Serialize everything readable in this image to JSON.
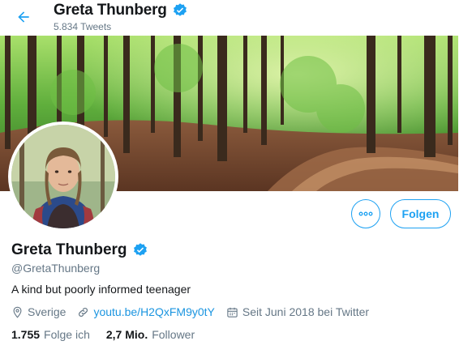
{
  "header": {
    "back_icon": "arrow-left-icon",
    "name": "Greta Thunberg",
    "verified_icon": "verified-badge-icon",
    "tweet_count": "5.834 Tweets"
  },
  "banner": {
    "description": "forest-path-photo"
  },
  "avatar": {
    "description": "profile-photo"
  },
  "actions": {
    "more_icon": "more-dots-icon",
    "follow_label": "Folgen"
  },
  "profile": {
    "name": "Greta Thunberg",
    "handle": "@GretaThunberg",
    "bio": "A kind but poorly informed teenager",
    "location": "Sverige",
    "link": "youtu.be/H2QxFM9y0tY",
    "joined": "Seit Juni 2018 bei Twitter"
  },
  "stats": {
    "following_count": "1.755",
    "following_label": "Folge ich",
    "followers_count": "2,7 Mio.",
    "followers_label": "Follower"
  },
  "colors": {
    "accent": "#1da1f2",
    "text": "#14171a",
    "secondary": "#657786"
  }
}
